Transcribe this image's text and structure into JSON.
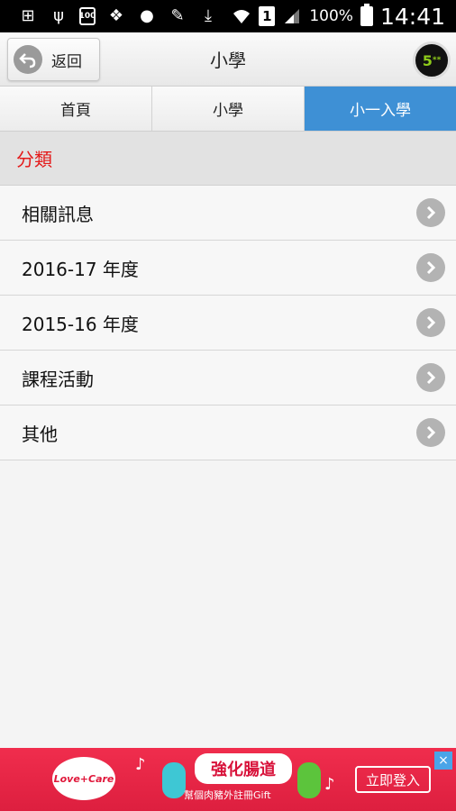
{
  "status_bar": {
    "icons": [
      "plus-box-icon",
      "usb-icon",
      "storage-icon",
      "dropbox-icon",
      "chat-icon",
      "edit-icon",
      "download-icon",
      "wifi-icon",
      "sim-icon",
      "signal-icon",
      "battery-icon"
    ],
    "storage_label": "100",
    "sim_label": "1",
    "battery_percent": "100%",
    "time": "14:41"
  },
  "header": {
    "back_label": "返回",
    "title": "小學",
    "logo_text": "5",
    "logo_stars": "**"
  },
  "tabs": [
    {
      "label": "首頁",
      "active": false
    },
    {
      "label": "小學",
      "active": false
    },
    {
      "label": "小一入學",
      "active": true
    }
  ],
  "section": {
    "title": "分類",
    "title_color": "#e41a1a"
  },
  "list": [
    {
      "label": "相關訊息"
    },
    {
      "label": "2016-17 年度"
    },
    {
      "label": "2015-16 年度"
    },
    {
      "label": "課程活動"
    },
    {
      "label": "其他"
    }
  ],
  "ad": {
    "brand": "Love+Care",
    "headline": "強化腸道",
    "subline": "幫個肉豬外註冊Gift",
    "cta_label": "立即登入",
    "close_label": "×"
  },
  "colors": {
    "accent_tab": "#3e90d5",
    "ad_background": "#e8294a"
  }
}
